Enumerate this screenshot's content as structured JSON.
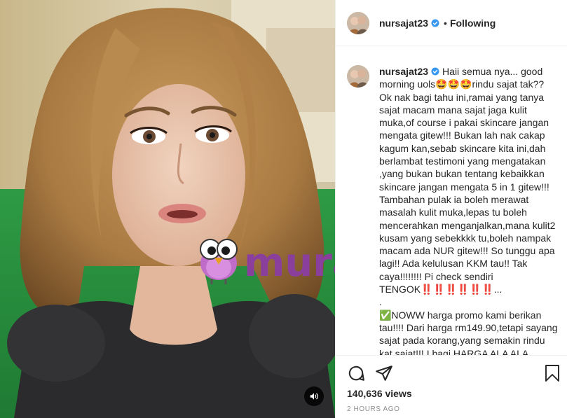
{
  "post": {
    "username": "nursajat23",
    "follow_label": "Following",
    "dot": "•",
    "caption": "Haii semua nya... good morning uols🤩🤩🤩rindu sajat tak?? Ok nak bagi tahu ini,ramai yang tanya sajat macam mana sajat jaga kulit muka,of course i pakai skincare jangan mengata gitew!!! Bukan lah nak cakap kagum kan,sebab skincare kita ini,dah berlambat testimoni yang mengatakan ,yang bukan bukan tentang kebaikkan skincare jangan mengata 5 in 1 gitew!!! Tambahan pulak ia boleh merawat masalah kulit muka,lepas tu boleh mencerahkan menganjalkan,mana kulit2 kusam yang sebekkkk tu,boleh nampak macam ada NUR gitew!!! So tunggu apa lagi!! Ada kelulusan KKM tau!! Tak caya!!!!!!!! Pi check sendiri TENGOK‼️‼️‼️‼️‼️‼️...\n.\n✅NOWW harga promo kami berikan tau!!!! Dari harga rm149.90,tetapi sayang sajat pada korang,yang semakin rindu kat sajat!!! I bagi HARGA ALA ALA",
    "views": "140,636 views",
    "time": "2 HOURS AGO"
  },
  "watermark": {
    "text": "murai",
    "color": "#8b3f9c"
  },
  "icons": {
    "verified": "verified-badge-icon",
    "comment": "comment-icon",
    "share": "share-icon",
    "save": "bookmark-icon",
    "mute": "speaker-icon"
  },
  "colors": {
    "verified_blue": "#3897f0",
    "text": "#262626",
    "muted": "#8e8e8e",
    "border": "#efefef"
  }
}
